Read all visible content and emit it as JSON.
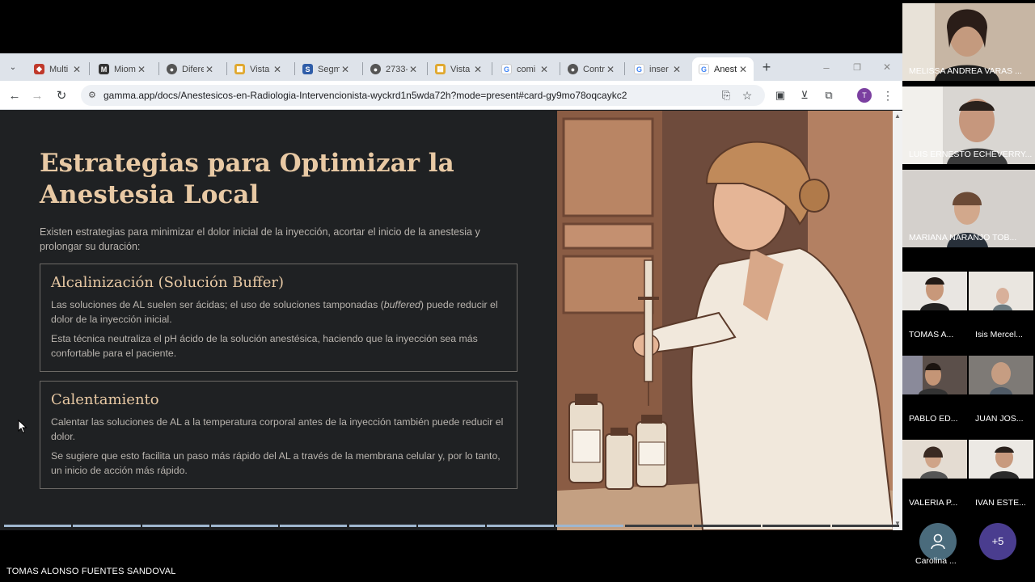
{
  "browser": {
    "tabs": [
      {
        "label": "Multi"
      },
      {
        "label": "Miom"
      },
      {
        "label": "Difere"
      },
      {
        "label": "Vista"
      },
      {
        "label": "Segm"
      },
      {
        "label": "2733-"
      },
      {
        "label": "Vista"
      },
      {
        "label": "comi"
      },
      {
        "label": "Contr"
      },
      {
        "label": "inser"
      },
      {
        "label": "Anest"
      }
    ],
    "url": "gamma.app/docs/Anestesicos-en-Radiologia-Intervencionista-wyckrd1n5wda72h?mode=present#card-gy9mo78oqcaykc2",
    "profile_initial": "T"
  },
  "slide": {
    "title": "Estrategias para Optimizar la Anestesia Local",
    "intro": "Existen estrategias para minimizar el dolor inicial de la inyección, acortar el inicio de la anestesia y prolongar su duración:",
    "cards": [
      {
        "heading": "Alcalinización (Solución Buffer)",
        "p1_before": "Las soluciones de AL suelen ser ácidas; el uso de soluciones tamponadas (",
        "p1_em": "buffered",
        "p1_after": ") puede reducir el dolor de la inyección inicial.",
        "p2": "Esta técnica neutraliza el pH ácido de la solución anestésica, haciendo que la inyección sea más confortable para el paciente."
      },
      {
        "heading": "Calentamiento",
        "p1": "Calentar las soluciones de AL a la temperatura corporal antes de la inyección también puede reducir el dolor.",
        "p2": "Se sugiere que esto facilita un paso más rápido del AL a través de la membrana celular y, por lo tanto, un inicio de acción más rápido."
      }
    ]
  },
  "meeting": {
    "participants": [
      {
        "name": "MELISSA ANDREA VARAS ..."
      },
      {
        "name": "LUIS ERNESTO ECHEVERRY..."
      },
      {
        "name": "MARIANA  NARANJO TOB..."
      }
    ],
    "small_participants": [
      {
        "name": "TOMAS A..."
      },
      {
        "name": "Isis Mercel..."
      },
      {
        "name": "PABLO ED..."
      },
      {
        "name": "JUAN JOS..."
      },
      {
        "name": "VALERIA P..."
      },
      {
        "name": "IVAN ESTE..."
      }
    ],
    "audio_only": {
      "name": "Carolina ..."
    },
    "more_count": "+5",
    "self_name": "TOMAS ALONSO FUENTES SANDOVAL"
  },
  "colors": {
    "accent_title": "#e8c9a4",
    "slide_bg": "#1f2123",
    "progress_done": "#9fb7cf"
  }
}
